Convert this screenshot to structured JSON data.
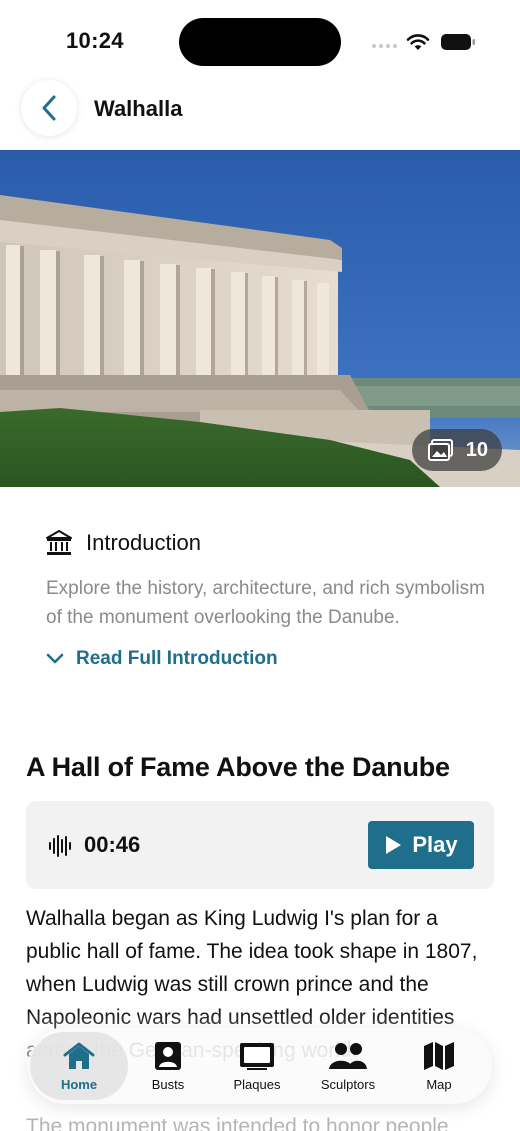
{
  "status_bar": {
    "time": "10:24"
  },
  "nav": {
    "title": "Walhalla"
  },
  "hero": {
    "photo_count": "10"
  },
  "intro": {
    "title": "Introduction",
    "text": "Explore the history, architecture, and rich symbolism of the monument overlooking the Danube.",
    "read_more": "Read Full Introduction"
  },
  "section": {
    "title": "A Hall of Fame Above the Danube"
  },
  "audio": {
    "duration": "00:46",
    "play_label": "Play"
  },
  "body": {
    "paragraph1": "Walhalla began as King Ludwig I's plan for a public hall of fame. The idea took shape in 1807, when Ludwig was still crown prince and the Napoleonic wars had unsettled older identities across the German-speaking world.",
    "paragraph2": "The monument was intended to honor people"
  },
  "tabs": [
    {
      "label": "Home",
      "icon": "home-icon"
    },
    {
      "label": "Busts",
      "icon": "bust-icon"
    },
    {
      "label": "Plaques",
      "icon": "plaque-icon"
    },
    {
      "label": "Sculptors",
      "icon": "sculptors-icon"
    },
    {
      "label": "Map",
      "icon": "map-icon"
    }
  ],
  "colors": {
    "accent": "#1f6e8c",
    "muted_text": "#8a8a8a",
    "card_bg": "#f2f2f2"
  }
}
